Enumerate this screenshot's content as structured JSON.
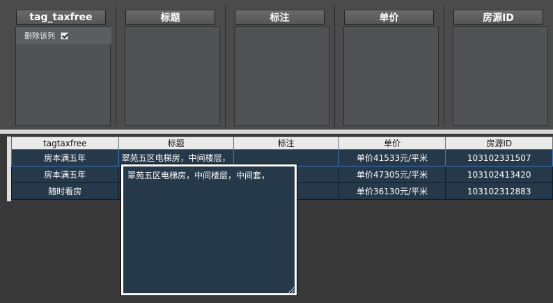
{
  "columns": [
    {
      "header": "tag_taxfree",
      "delete_label": "删除该列"
    },
    {
      "header": "标题"
    },
    {
      "header": "标注"
    },
    {
      "header": "单价"
    },
    {
      "header": "房源ID"
    }
  ],
  "grid": {
    "headers": [
      "tagtaxfree",
      "标题",
      "标注",
      "单价",
      "房源ID"
    ],
    "rows": [
      [
        "房本满五年",
        "翠苑五区电梯房，中间楼层，",
        "",
        "单价41533元/平米",
        "103102331507"
      ],
      [
        "房本满五年",
        "",
        "",
        "单价47305元/平米",
        "103102413420"
      ],
      [
        "随时看房",
        "",
        "",
        "单价36130元/平米",
        "103102312883"
      ]
    ]
  },
  "editor": {
    "text": "翠苑五区电梯房，中间楼层，中间套，"
  }
}
